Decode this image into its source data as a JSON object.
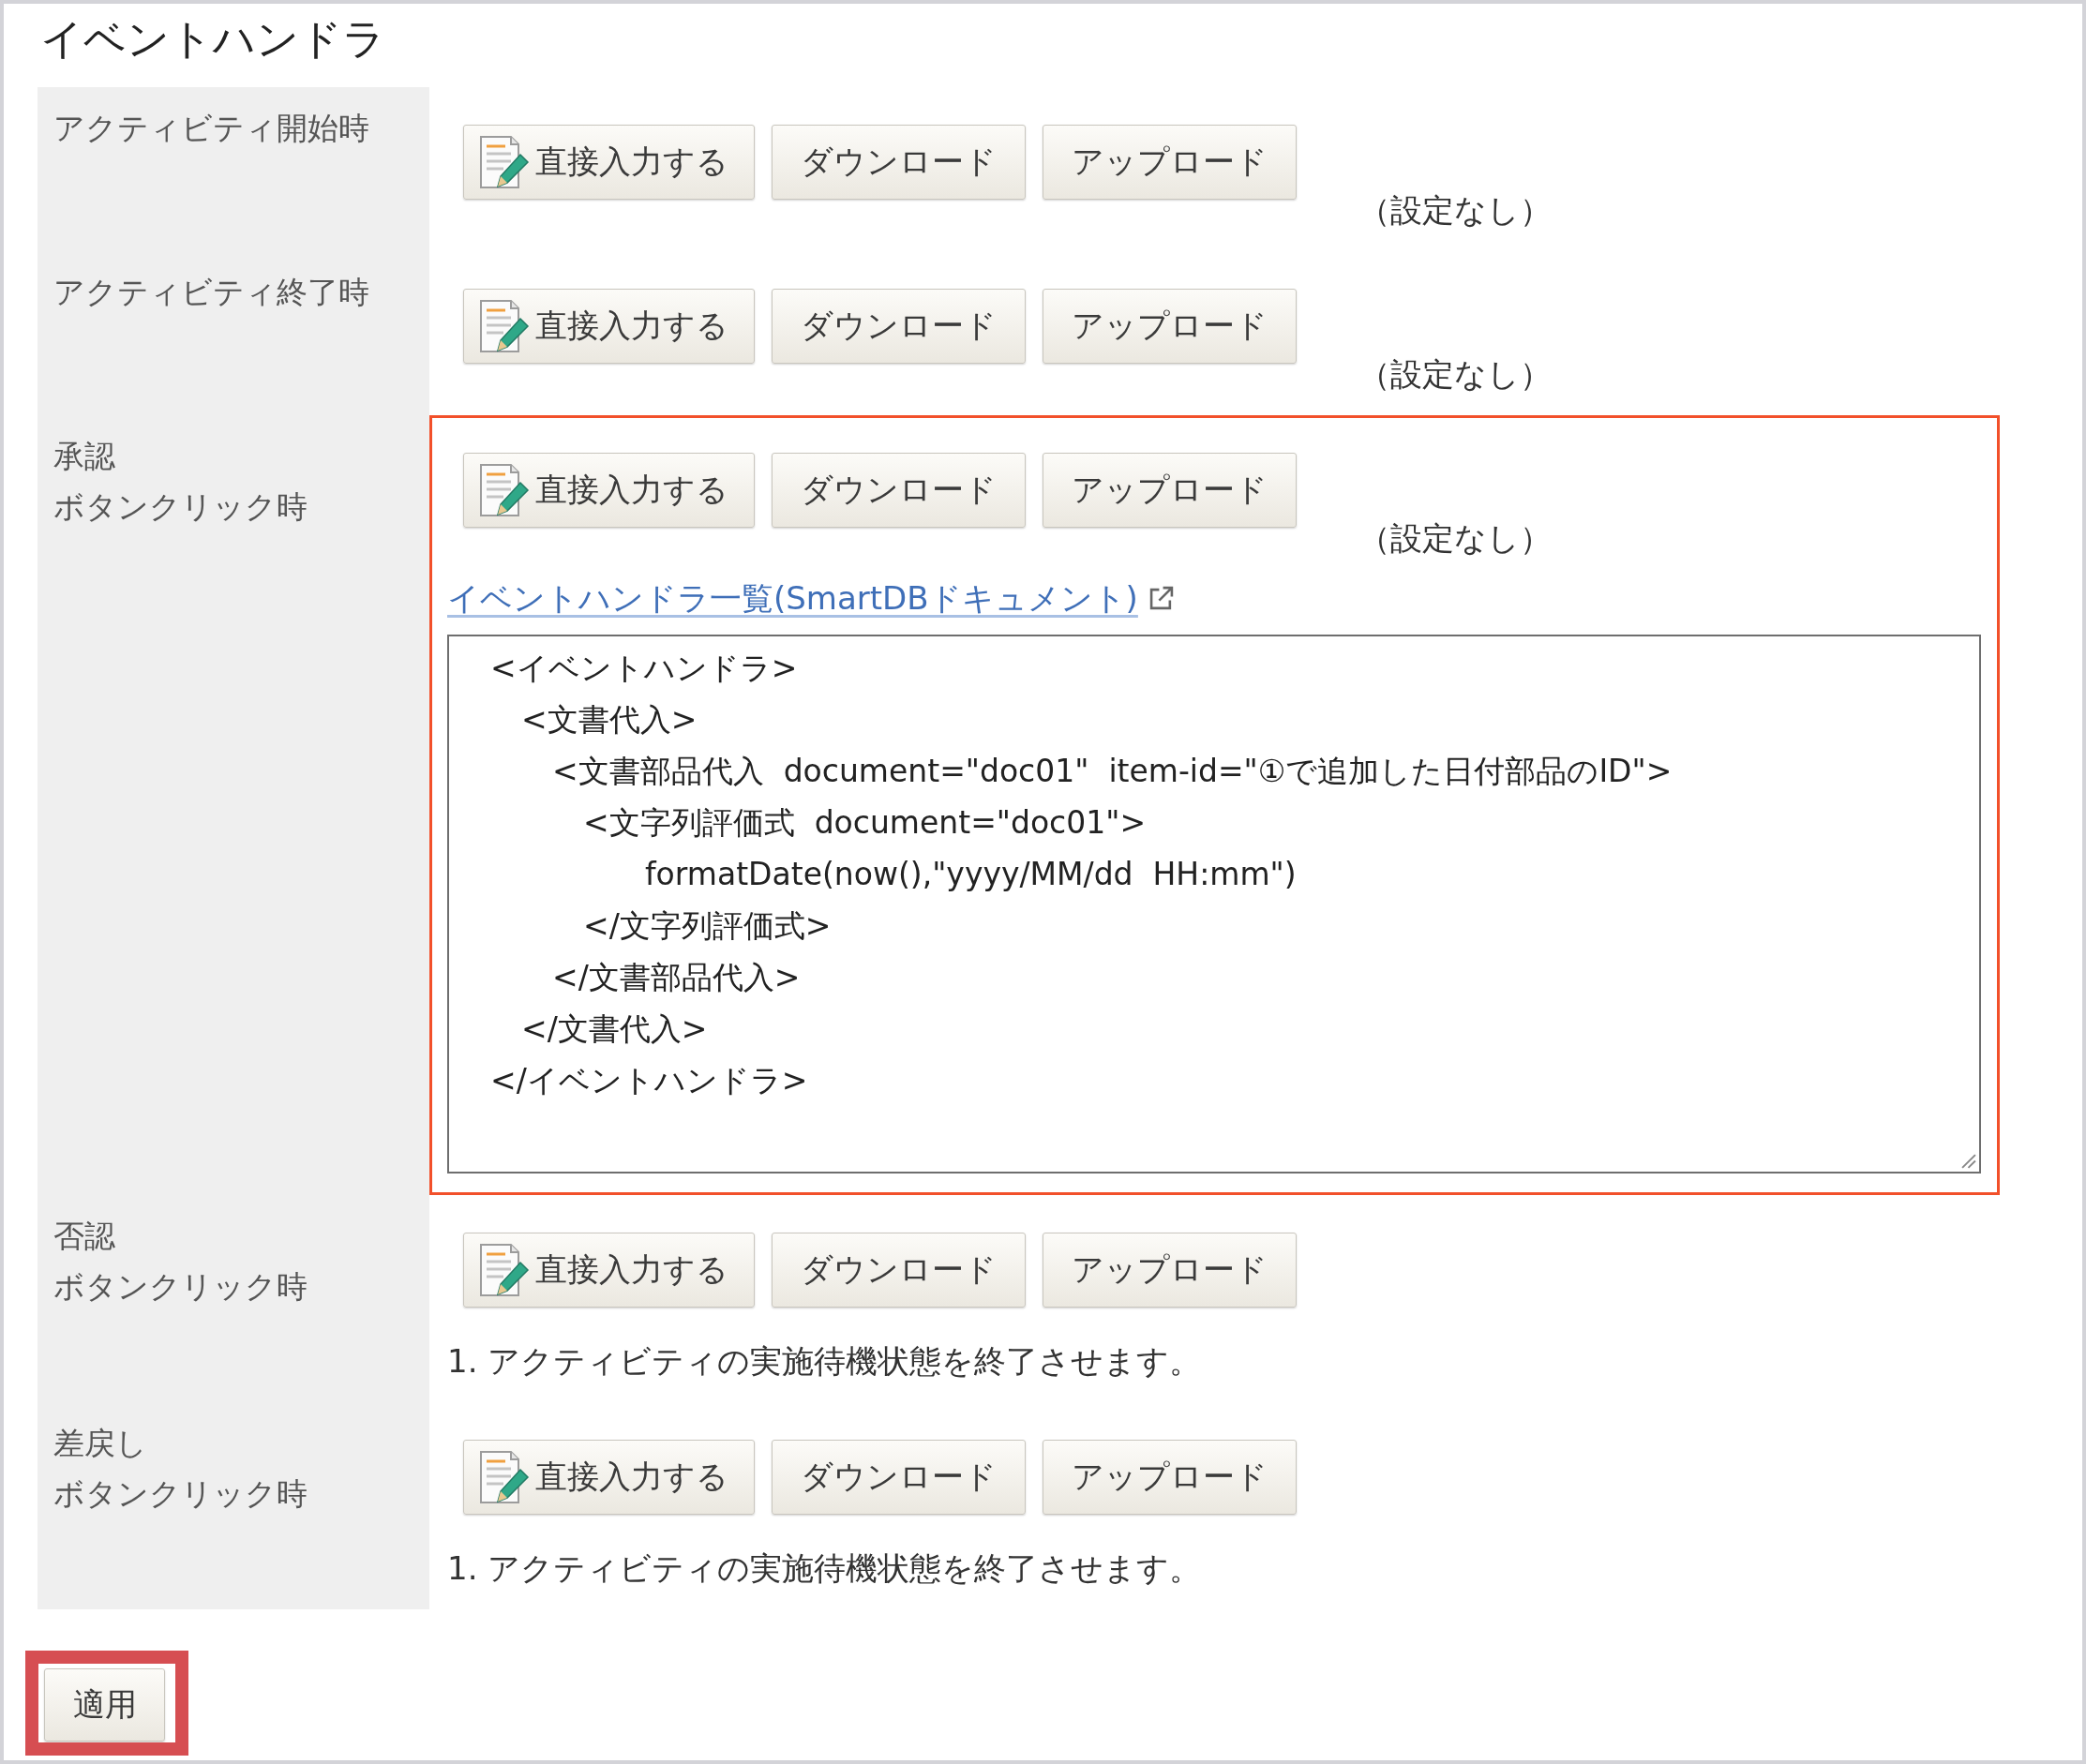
{
  "title": "イベントハンドラ",
  "handlers": [
    {
      "label_lines": [
        "アクティビティ開始時"
      ],
      "highlighted": false,
      "buttons": [
        {
          "kind": "edit",
          "label": "直接入力する"
        },
        {
          "kind": "plain",
          "label": "ダウンロード"
        },
        {
          "kind": "plain",
          "label": "アップロード"
        }
      ],
      "status": "（設定なし）"
    },
    {
      "label_lines": [
        "アクティビティ終了時"
      ],
      "highlighted": false,
      "buttons": [
        {
          "kind": "edit",
          "label": "直接入力する"
        },
        {
          "kind": "plain",
          "label": "ダウンロード"
        },
        {
          "kind": "plain",
          "label": "アップロード"
        }
      ],
      "status": "（設定なし）"
    },
    {
      "label_lines": [
        "承認",
        "ボタンクリック時"
      ],
      "highlighted": true,
      "buttons": [
        {
          "kind": "edit",
          "label": "直接入力する"
        },
        {
          "kind": "plain",
          "label": "ダウンロード"
        },
        {
          "kind": "plain",
          "label": "アップロード"
        }
      ],
      "status": "（設定なし）",
      "link": {
        "label": "イベントハンドラ一覧(SmartDBドキュメント)"
      },
      "editor": {
        "value": "<イベントハンドラ>\n　<文書代入>\n　　<文書部品代入  document=\"doc01\"  item-id=\"①で追加した日付部品のID\">\n　　　<文字列評価式  document=\"doc01\">\n　　　　　formatDate(now(),\"yyyy/MM/dd  HH:mm\")\n　　　</文字列評価式>\n　　</文書部品代入>\n　</文書代入>\n</イベントハンドラ>"
      }
    },
    {
      "label_lines": [
        "否認",
        "ボタンクリック時"
      ],
      "highlighted": false,
      "buttons": [
        {
          "kind": "edit",
          "label": "直接入力する"
        },
        {
          "kind": "plain",
          "label": "ダウンロード"
        },
        {
          "kind": "plain",
          "label": "アップロード"
        }
      ],
      "note": "1. アクティビティの実施待機状態を終了させます。"
    },
    {
      "label_lines": [
        "差戻し",
        "ボタンクリック時"
      ],
      "highlighted": false,
      "buttons": [
        {
          "kind": "edit",
          "label": "直接入力する"
        },
        {
          "kind": "plain",
          "label": "ダウンロード"
        },
        {
          "kind": "plain",
          "label": "アップロード"
        }
      ],
      "note": "1. アクティビティの実施待機状態を終了させます。"
    }
  ],
  "apply_button": {
    "label": "適用",
    "highlighted": true
  }
}
